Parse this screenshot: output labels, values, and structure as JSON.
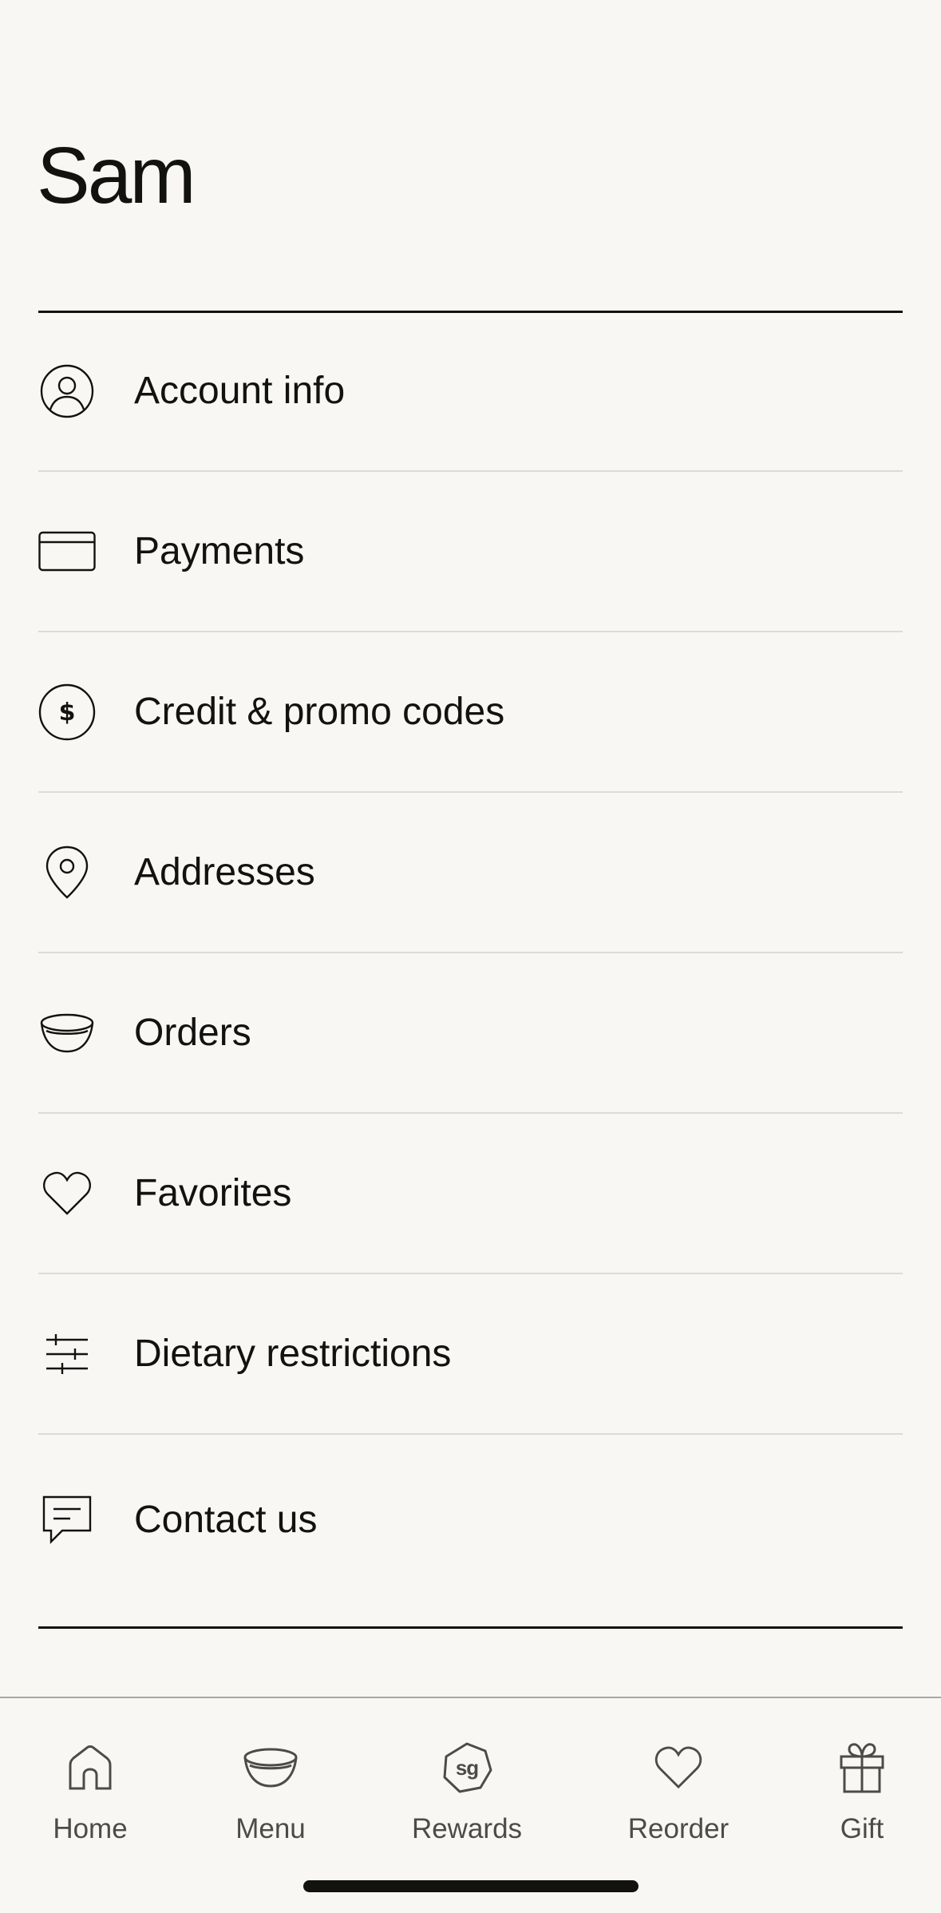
{
  "header": {
    "title": "Sam"
  },
  "menu": {
    "items": [
      {
        "label": "Account info",
        "icon": "person-circle-icon"
      },
      {
        "label": "Payments",
        "icon": "credit-card-icon"
      },
      {
        "label": "Credit & promo codes",
        "icon": "dollar-circle-icon"
      },
      {
        "label": "Addresses",
        "icon": "map-pin-icon"
      },
      {
        "label": "Orders",
        "icon": "bowl-icon"
      },
      {
        "label": "Favorites",
        "icon": "heart-icon"
      },
      {
        "label": "Dietary restrictions",
        "icon": "sliders-icon"
      },
      {
        "label": "Contact us",
        "icon": "chat-bubble-icon"
      }
    ]
  },
  "tabbar": {
    "tabs": [
      {
        "label": "Home",
        "icon": "home-icon"
      },
      {
        "label": "Menu",
        "icon": "bowl-icon"
      },
      {
        "label": "Rewards",
        "icon": "sg-badge-icon",
        "badge_text": "sg"
      },
      {
        "label": "Reorder",
        "icon": "heart-icon"
      },
      {
        "label": "Gift",
        "icon": "gift-icon"
      }
    ]
  },
  "colors": {
    "background": "#f8f7f3",
    "text": "#12130f",
    "divider": "#dcdbd6",
    "tab_label": "#4b4c48"
  }
}
